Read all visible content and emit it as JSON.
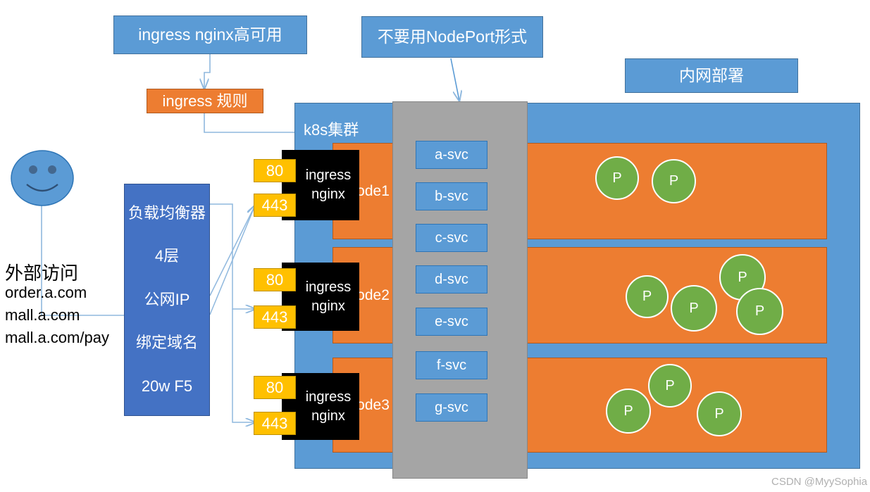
{
  "notes": {
    "ingress_ha": "ingress nginx高可用",
    "no_nodeport": "不要用NodePort形式",
    "intranet_deploy": "内网部署",
    "ingress_rule": "ingress 规则"
  },
  "cluster": {
    "label": "k8s集群"
  },
  "external": {
    "title": "外部访问",
    "domains": [
      "order.a.com",
      "mall.a.com",
      "mall.a.com/pay"
    ],
    "smiley_icon": "smiley-face-icon"
  },
  "load_balancer": {
    "lines": [
      "负载均衡器",
      "4层",
      "公网IP",
      "绑定域名",
      "20w F5"
    ]
  },
  "ingress_instances": [
    {
      "ports": [
        "80",
        "443"
      ],
      "line1": "ingress",
      "line2": "nginx"
    },
    {
      "ports": [
        "80",
        "443"
      ],
      "line1": "ingress",
      "line2": "nginx"
    },
    {
      "ports": [
        "80",
        "443"
      ],
      "line1": "ingress",
      "line2": "nginx"
    }
  ],
  "services": [
    "a-svc",
    "b-svc",
    "c-svc",
    "d-svc",
    "e-svc",
    "f-svc",
    "g-svc"
  ],
  "nodes": [
    {
      "label": "Node1",
      "pods": [
        "P",
        "P"
      ]
    },
    {
      "label": "Node2",
      "pods": [
        "P",
        "P",
        "P",
        "P"
      ]
    },
    {
      "label": "Node3",
      "pods": [
        "P",
        "P",
        "P"
      ]
    }
  ],
  "pod_label": "P",
  "watermark": "CSDN @MyySophia",
  "colors": {
    "blue_note": "#5B9BD5",
    "orange": "#ED7D31",
    "grey_column": "#A5A5A5",
    "lb_blue": "#4472C4",
    "port_yellow": "#FFC000",
    "pod_green": "#70AD47",
    "black": "#000000",
    "connector": "#8FB8DE"
  }
}
